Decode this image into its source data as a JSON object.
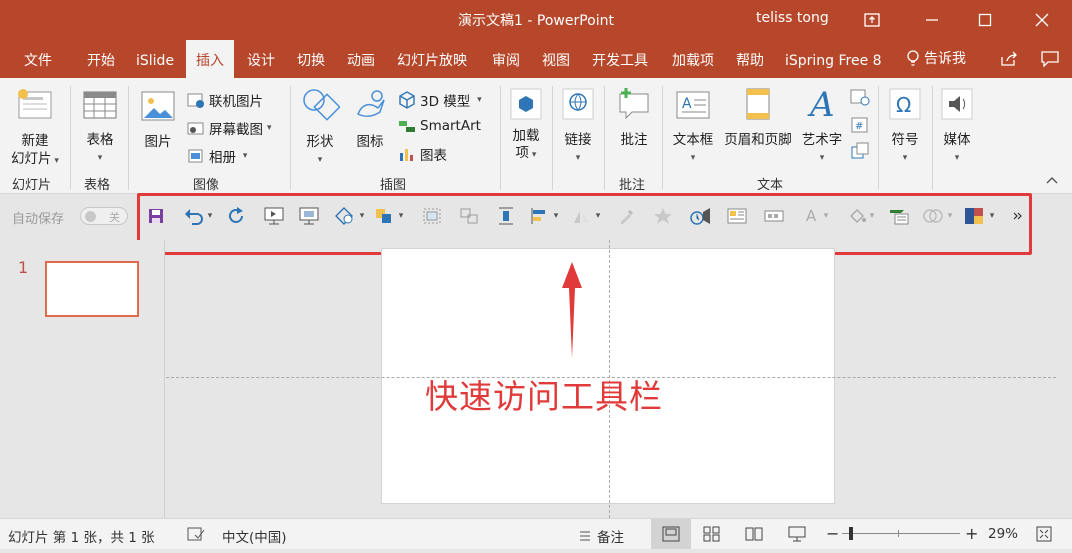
{
  "window": {
    "title": "演示文稿1  -  PowerPoint",
    "user": "teliss tong"
  },
  "tabs": [
    "文件",
    "开始",
    "iSlide",
    "插入",
    "设计",
    "切换",
    "动画",
    "幻灯片放映",
    "审阅",
    "视图",
    "开发工具",
    "加载项",
    "帮助",
    "iSpring Free 8",
    "告诉我"
  ],
  "active_tab": "插入",
  "ribbon": {
    "slides": {
      "new_slide": "新建\n幻灯片",
      "new_slide_1": "新建",
      "new_slide_2": "幻灯片",
      "group": "幻灯片"
    },
    "tables": {
      "table": "表格",
      "group": "表格"
    },
    "images": {
      "picture": "图片",
      "online_pictures": "联机图片",
      "screenshot": "屏幕截图",
      "album": "相册",
      "group": "图像"
    },
    "illustrations": {
      "shapes": "形状",
      "icons": "图标",
      "models3d": "3D 模型",
      "smartart": "SmartArt",
      "chart": "图表",
      "group": "插图"
    },
    "addins": {
      "label1": "加载",
      "label2": "项"
    },
    "links": {
      "link": "链接"
    },
    "comments": {
      "comment": "批注",
      "group": "批注"
    },
    "text": {
      "textbox": "文本框",
      "header_footer": "页眉和页脚",
      "wordart": "艺术字",
      "group": "文本"
    },
    "symbols": {
      "symbol": "符号"
    },
    "media": {
      "media": "媒体"
    }
  },
  "qat": {
    "autosave_label": "自动保存",
    "autosave_state": "关"
  },
  "slides": {
    "current_number": "1"
  },
  "annotation": {
    "text": "快速访问工具栏",
    "color": "#e03a3a"
  },
  "status": {
    "slide_info": "幻灯片 第 1 张，共 1 张",
    "language": "中文(中国)",
    "notes": "备注",
    "zoom": "29%"
  }
}
